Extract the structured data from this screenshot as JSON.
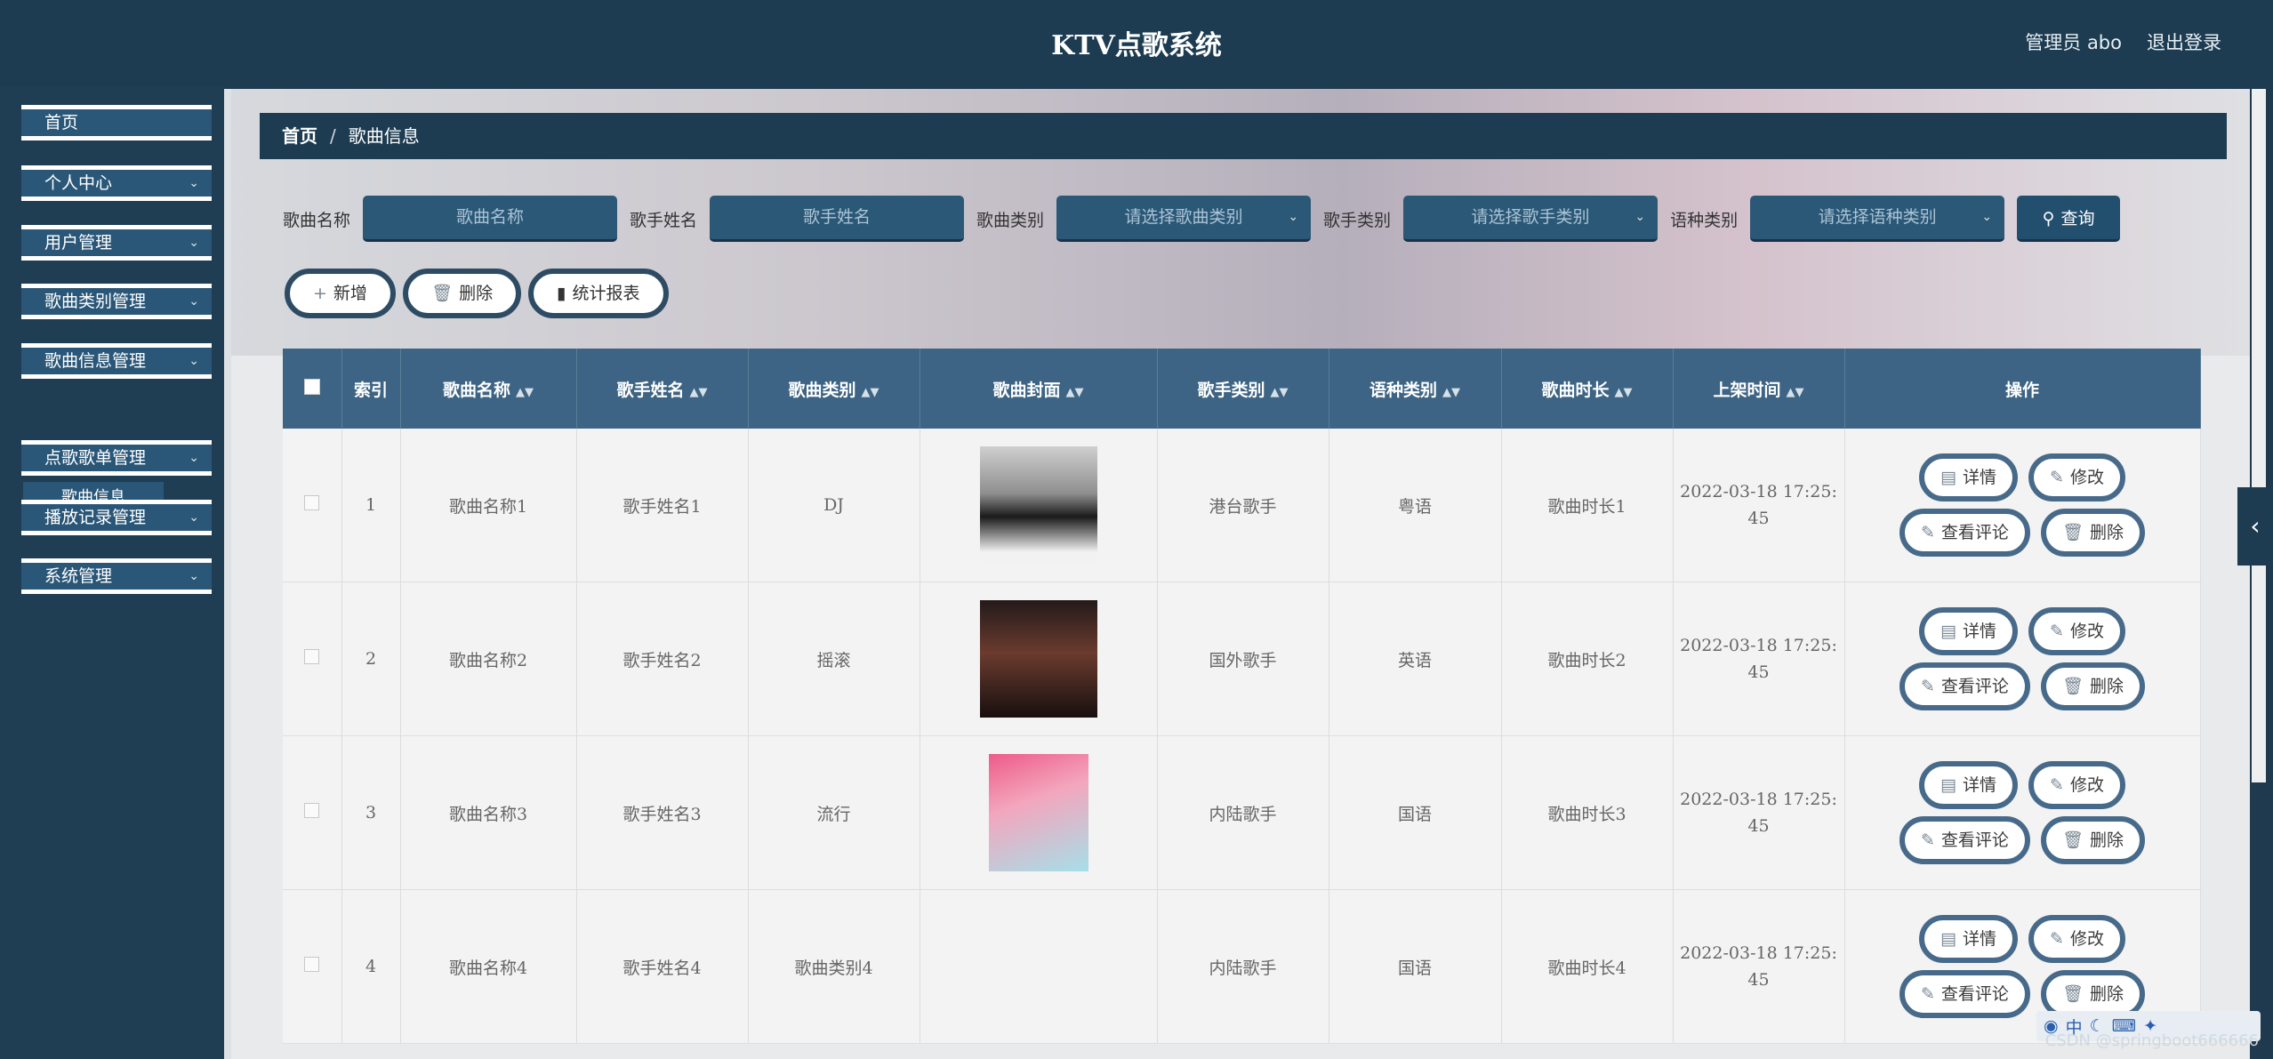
{
  "app": {
    "title": "KTV点歌系统",
    "admin_label": "管理员 abo",
    "logout": "退出登录"
  },
  "sidebar": {
    "items": [
      {
        "label": "首页",
        "has_sub": false
      },
      {
        "label": "个人中心",
        "has_sub": true
      },
      {
        "label": "用户管理",
        "has_sub": true
      },
      {
        "label": "歌曲类别管理",
        "has_sub": true
      },
      {
        "label": "歌曲信息管理",
        "has_sub": true
      },
      {
        "label": "点歌歌单管理",
        "has_sub": true
      },
      {
        "label": "播放记录管理",
        "has_sub": true
      },
      {
        "label": "系统管理",
        "has_sub": true
      }
    ],
    "active_sub": "歌曲信息"
  },
  "breadcrumb": {
    "home": "首页",
    "separator": "/",
    "current": "歌曲信息"
  },
  "filters": {
    "song_name": {
      "label": "歌曲名称",
      "placeholder": "歌曲名称"
    },
    "singer_name": {
      "label": "歌手姓名",
      "placeholder": "歌手姓名"
    },
    "song_type": {
      "label": "歌曲类别",
      "placeholder": "请选择歌曲类别"
    },
    "singer_type": {
      "label": "歌手类别",
      "placeholder": "请选择歌手类别"
    },
    "language": {
      "label": "语种类别",
      "placeholder": "请选择语种类别"
    },
    "query": "查询"
  },
  "actions": {
    "add": "新增",
    "delete": "删除",
    "report": "统计报表"
  },
  "table": {
    "headers": {
      "index": "索引",
      "song_name": "歌曲名称",
      "singer_name": "歌手姓名",
      "song_type": "歌曲类别",
      "cover": "歌曲封面",
      "singer_type": "歌手类别",
      "language": "语种类别",
      "duration": "歌曲时长",
      "time": "上架时间",
      "ops": "操作"
    },
    "rows": [
      {
        "index": "1",
        "song_name": "歌曲名称1",
        "singer_name": "歌手姓名1",
        "song_type": "DJ",
        "singer_type": "港台歌手",
        "language": "粤语",
        "duration": "歌曲时长1",
        "time_a": "2022-03-18 17:25:",
        "time_b": "45"
      },
      {
        "index": "2",
        "song_name": "歌曲名称2",
        "singer_name": "歌手姓名2",
        "song_type": "摇滚",
        "singer_type": "国外歌手",
        "language": "英语",
        "duration": "歌曲时长2",
        "time_a": "2022-03-18 17:25:",
        "time_b": "45"
      },
      {
        "index": "3",
        "song_name": "歌曲名称3",
        "singer_name": "歌手姓名3",
        "song_type": "流行",
        "singer_type": "内陆歌手",
        "language": "国语",
        "duration": "歌曲时长3",
        "time_a": "2022-03-18 17:25:",
        "time_b": "45"
      },
      {
        "index": "4",
        "song_name": "歌曲名称4",
        "singer_name": "歌手姓名4",
        "song_type": "歌曲类别4",
        "singer_type": "内陆歌手",
        "language": "国语",
        "duration": "歌曲时长4",
        "time_a": "2022-03-18 17:25:",
        "time_b": "45"
      }
    ],
    "ops": {
      "detail": "详情",
      "edit": "修改",
      "comments": "查看评论",
      "delete": "删除"
    }
  },
  "watermark": "CSDN @springboot666666",
  "ime": {
    "label": "中"
  }
}
